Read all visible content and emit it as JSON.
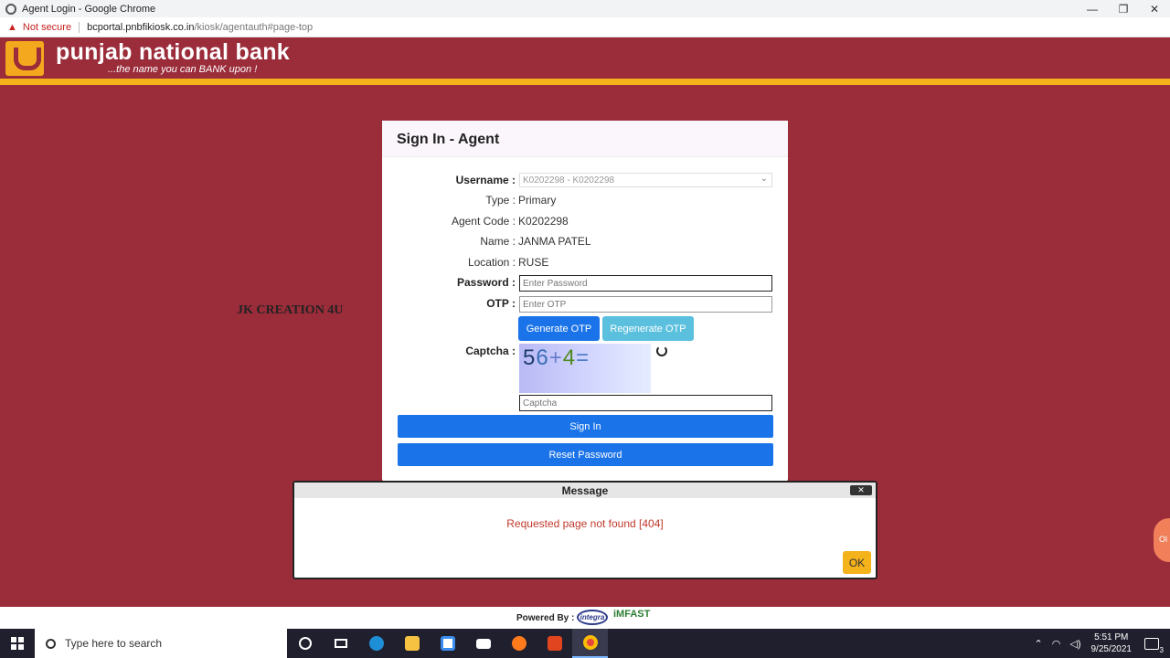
{
  "browser": {
    "window_title": "Agent Login - Google Chrome",
    "security_label": "Not secure",
    "url_host": "bcportal.pnbfikiosk.co.in",
    "url_path": "/kiosk/agentauth#page-top",
    "controls": {
      "minimize": "—",
      "restore": "❐",
      "close": "✕"
    }
  },
  "header": {
    "bank_name": "punjab national bank",
    "tagline": "...the name you can BANK upon !"
  },
  "watermark": "JK CREATION 4U",
  "signin": {
    "title": "Sign In - Agent",
    "username_label": "Username :",
    "username_value": "K0202298 - K0202298",
    "type_label": "Type :",
    "type_value": "Primary",
    "agent_code_label": "Agent Code :",
    "agent_code_value": "K0202298",
    "name_label": "Name :",
    "name_value": "JANMA PATEL",
    "location_label": "Location :",
    "location_value": "RUSE",
    "password_label": "Password :",
    "password_placeholder": "Enter Password",
    "otp_label": "OTP :",
    "otp_placeholder": "Enter OTP",
    "generate_otp": "Generate OTP",
    "regenerate_otp": "Regenerate OTP",
    "captcha_label": "Captcha :",
    "captcha_chars": [
      "5",
      "6",
      "+",
      "4",
      "="
    ],
    "captcha_placeholder": "Captcha",
    "signin_button": "Sign In",
    "reset_button": "Reset Password"
  },
  "dialog": {
    "title": "Message",
    "close": "✕",
    "message": "Requested page not found [404]",
    "ok": "OK"
  },
  "side_bubble": "Ol",
  "footer": {
    "powered_by": "Powered By :",
    "integra": "integra",
    "imfast": "iMFAST"
  },
  "taskbar": {
    "search_placeholder": "Type here to search",
    "time": "5:51 PM",
    "date": "9/25/2021",
    "notification_count": "3"
  }
}
